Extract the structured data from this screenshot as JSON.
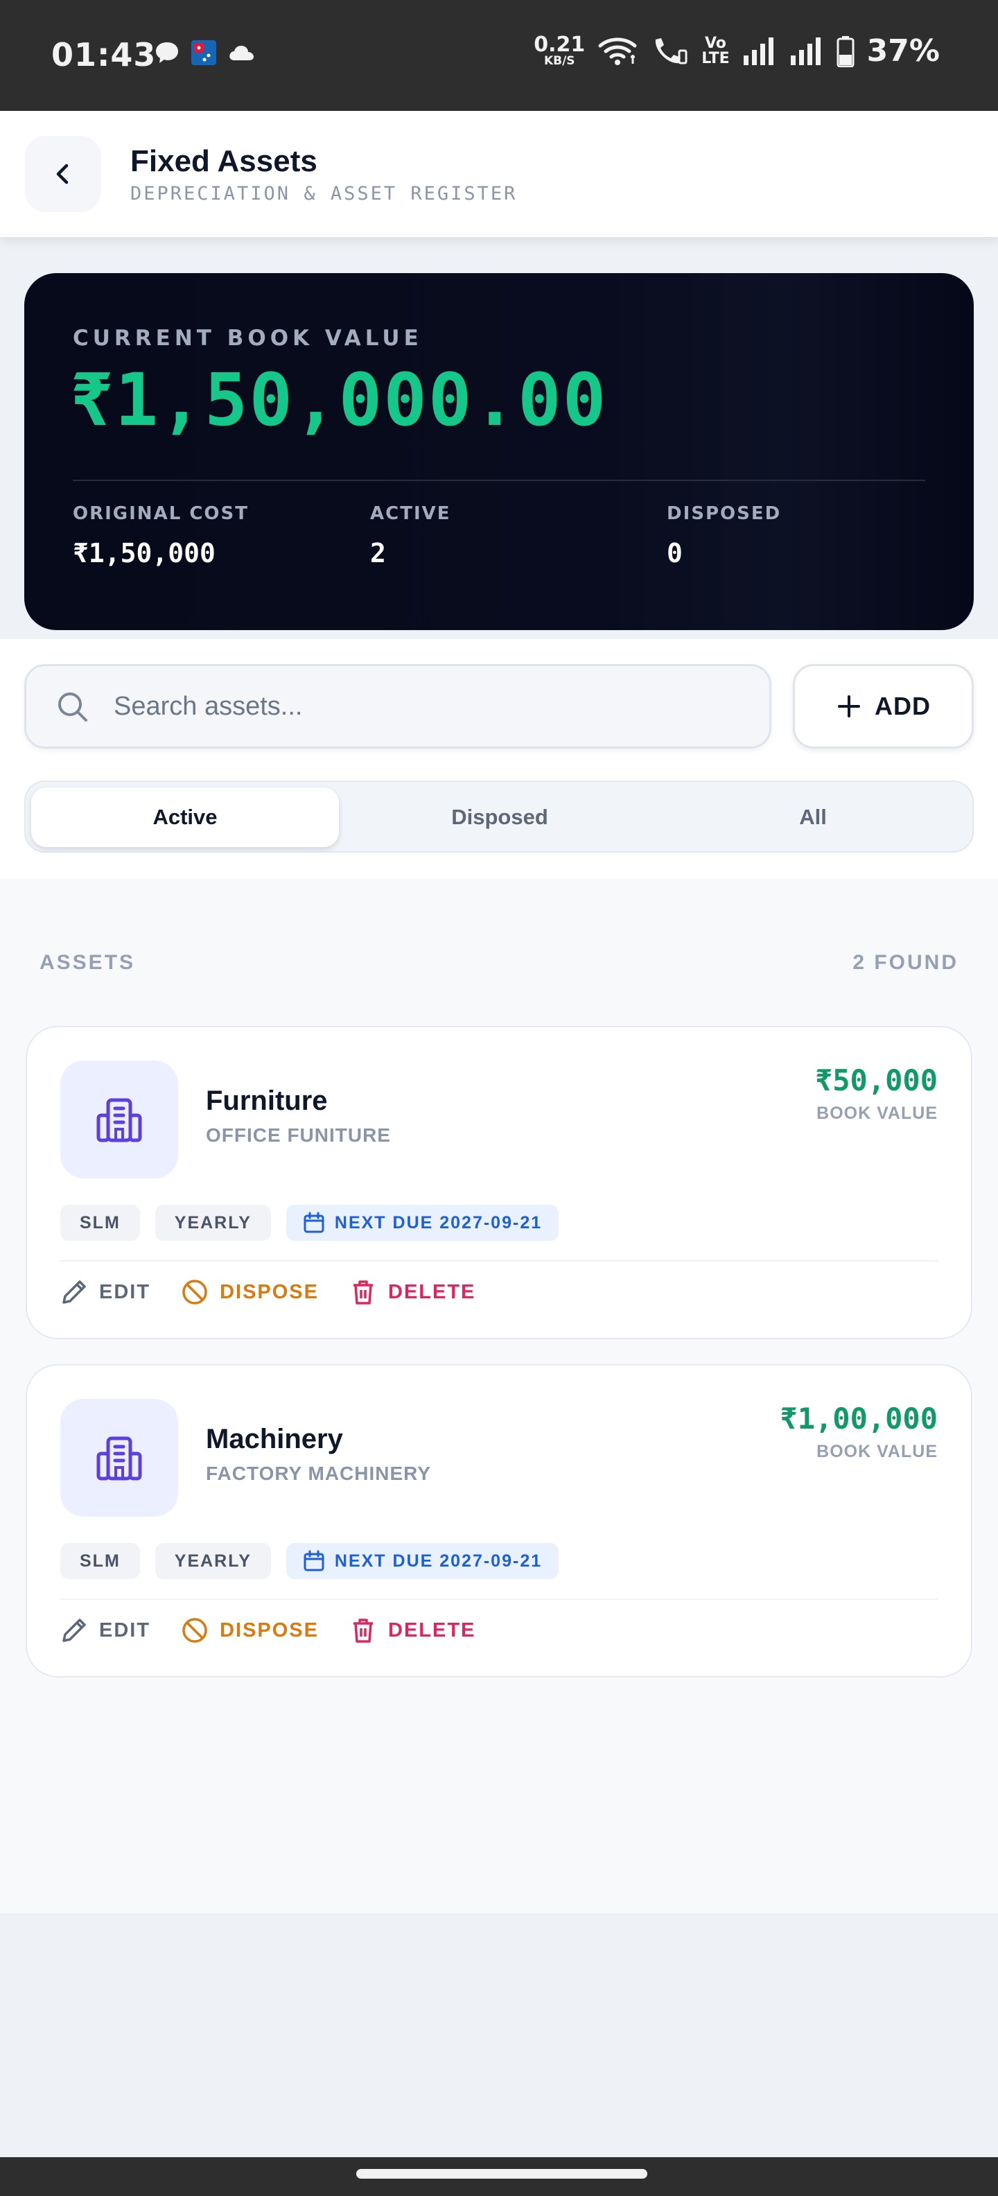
{
  "status_bar": {
    "time": "01:43",
    "speed_value": "0.21",
    "speed_unit": "KB/S",
    "volte_top": "Vo",
    "volte_bottom": "LTE",
    "battery": "37%"
  },
  "header": {
    "title": "Fixed Assets",
    "subtitle": "DEPRECIATION & ASSET REGISTER"
  },
  "summary": {
    "label": "CURRENT BOOK VALUE",
    "value": "₹1,50,000.00",
    "stats": [
      {
        "label": "ORIGINAL COST",
        "value": "₹1,50,000"
      },
      {
        "label": "ACTIVE",
        "value": "2"
      },
      {
        "label": "DISPOSED",
        "value": "0"
      }
    ]
  },
  "search": {
    "placeholder": "Search assets...",
    "value": ""
  },
  "add_button": {
    "label": "ADD"
  },
  "tabs": [
    {
      "label": "Active",
      "active": true
    },
    {
      "label": "Disposed",
      "active": false
    },
    {
      "label": "All",
      "active": false
    }
  ],
  "list": {
    "heading": "ASSETS",
    "count": "2 FOUND"
  },
  "assets": [
    {
      "name": "Furniture",
      "category": "OFFICE FUNITURE",
      "book_value": "₹50,000",
      "book_value_label": "BOOK VALUE",
      "method": "SLM",
      "frequency": "YEARLY",
      "next_due": "NEXT DUE 2027-09-21",
      "actions": {
        "edit": "EDIT",
        "dispose": "DISPOSE",
        "delete": "DELETE"
      }
    },
    {
      "name": "Machinery",
      "category": "FACTORY MACHINERY",
      "book_value": "₹1,00,000",
      "book_value_label": "BOOK VALUE",
      "method": "SLM",
      "frequency": "YEARLY",
      "next_due": "NEXT DUE 2027-09-21",
      "actions": {
        "edit": "EDIT",
        "dispose": "DISPOSE",
        "delete": "DELETE"
      }
    }
  ],
  "colors": {
    "accent_green": "#15c88a",
    "book_value_green": "#0f9a67",
    "dispose_orange": "#d97a0f",
    "delete_red": "#e0245e",
    "due_blue": "#1d5fd6",
    "asset_icon_purple": "#5b3fe0"
  }
}
